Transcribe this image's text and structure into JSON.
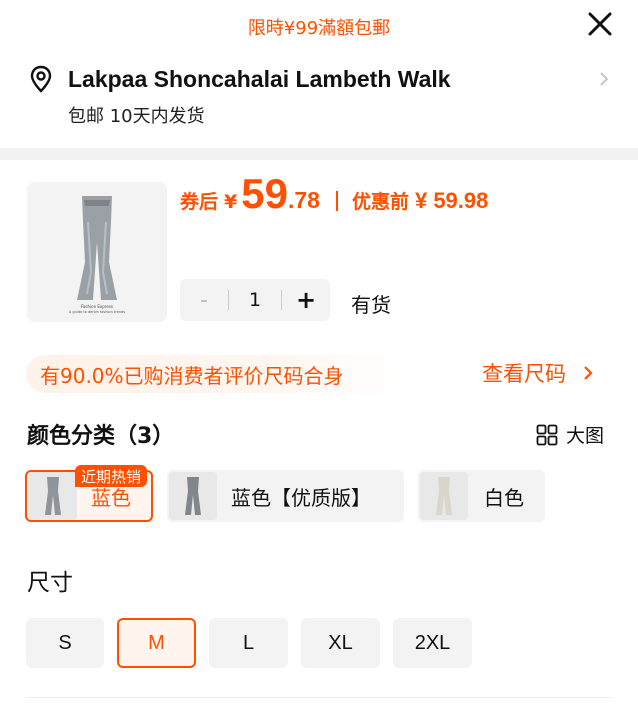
{
  "header": {
    "promo": "限時¥99滿額包郵",
    "close_icon": "close-icon"
  },
  "address": {
    "icon": "location-pin-icon",
    "name": "Lakpaa Shoncahalai Lambeth Walk",
    "shipping": "包邮 10天内发货"
  },
  "product": {
    "thumb_caption_1": "Fashion Express",
    "thumb_caption_2": "A guide to denim fashion trends",
    "price_label": "券后",
    "currency": "¥",
    "price_int": "59",
    "price_dec": ".78",
    "original_label": "优惠前",
    "original_price": "¥ 59.98",
    "qty_minus": "-",
    "qty": "1",
    "qty_plus": "+",
    "stock": "有货"
  },
  "fit": {
    "text": "有90.0%已购消费者评价尺码合身",
    "link": "查看尺码"
  },
  "colors": {
    "title": "颜色分类（3）",
    "big_view": "大图",
    "hot_badge": "近期热销",
    "options": [
      {
        "label": "蓝色",
        "selected": true
      },
      {
        "label": "蓝色【优质版】",
        "selected": false
      },
      {
        "label": "白色",
        "selected": false
      }
    ]
  },
  "sizes": {
    "title": "尺寸",
    "options": [
      {
        "label": "S",
        "selected": false
      },
      {
        "label": "M",
        "selected": true
      },
      {
        "label": "L",
        "selected": false
      },
      {
        "label": "XL",
        "selected": false
      },
      {
        "label": "2XL",
        "selected": false
      }
    ]
  },
  "theme": {
    "accent": "#ff5000",
    "chip_bg": "#f3f3f3"
  }
}
